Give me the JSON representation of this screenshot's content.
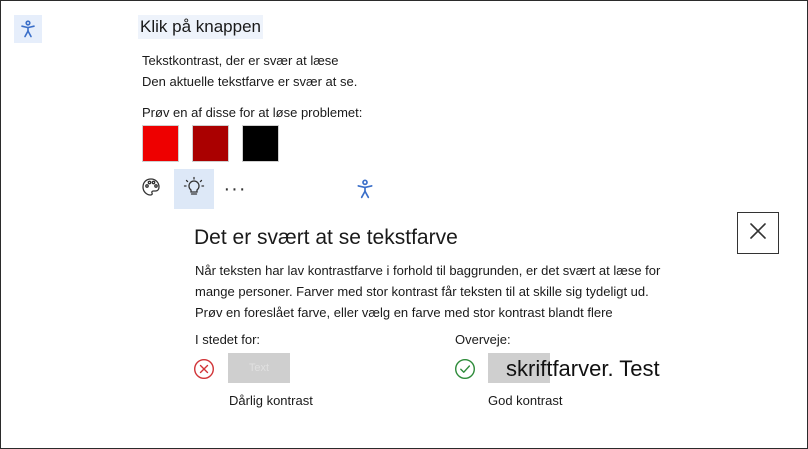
{
  "button_title": "Klik på knappen",
  "issue": {
    "title": "Tekstkontrast, der er svær at læse",
    "subtitle": "Den aktuelle tekstfarve er svær at se."
  },
  "suggestions": {
    "label": "Prøv en af disse for at løse problemet:",
    "colors": [
      "#ee0000",
      "#aa0000",
      "#000000"
    ]
  },
  "toolbar": {
    "more_label": "···"
  },
  "panel": {
    "heading": "Det er svært at se tekstfarve",
    "description": "Når teksten har lav kontrastfarve i forhold til baggrunden, er det svært at læse for mange personer. Farver med stor kontrast får teksten til at skille sig tydeligt ud. Prøv en foreslået farve, eller vælg en farve med stor kontrast blandt flere",
    "instead_label": "I stedet for:",
    "consider_label": "Overveje:",
    "bad_sample_text": "Text",
    "bad_caption": "Dårlig kontrast",
    "good_sample_text": "skriftfarver. Test",
    "good_caption": "God kontrast"
  },
  "colors": {
    "accent": "#3b6fc9",
    "bad": "#d13438",
    "good": "#2e8b3a",
    "highlight": "#dde8f7"
  }
}
